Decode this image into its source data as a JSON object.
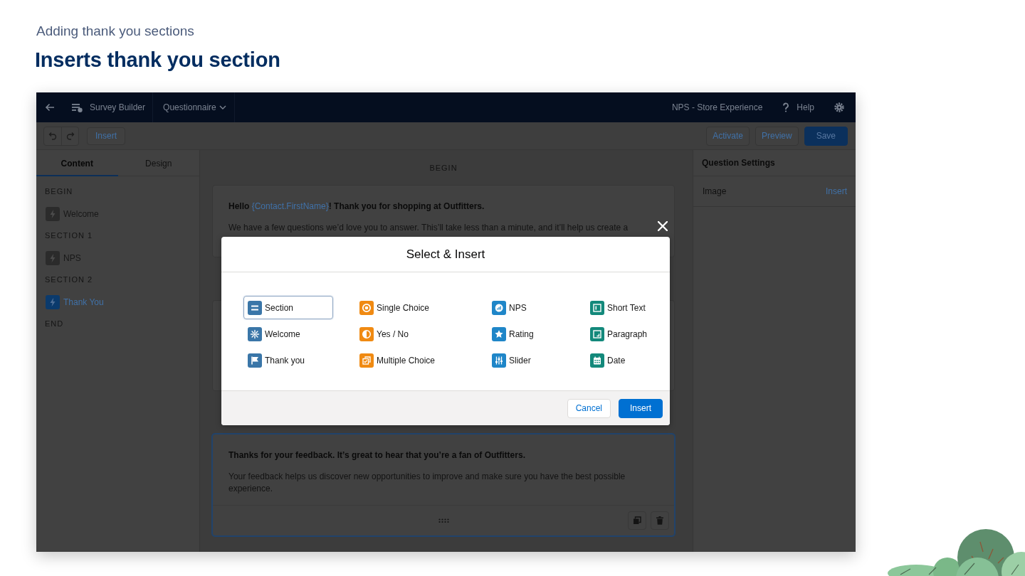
{
  "slide": {
    "subtitle": "Adding thank you sections",
    "title": "Inserts thank you section"
  },
  "window": {
    "nav": {
      "app_name": "Survey Builder",
      "menu": "Questionnaire",
      "survey_name": "NPS - Store Experience",
      "help": "Help"
    },
    "toolbar": {
      "insert": "Insert",
      "actions": [
        {
          "label": "Activate",
          "kind": "neutral"
        },
        {
          "label": "Preview",
          "kind": "neutral"
        },
        {
          "label": "Save",
          "kind": "brand"
        }
      ]
    },
    "sidebar": {
      "tabs": [
        {
          "label": "Content",
          "selected": true
        },
        {
          "label": "Design",
          "selected": false
        }
      ],
      "outline": [
        {
          "heading": "BEGIN",
          "pages": [
            {
              "label": "Welcome",
              "selected": false
            }
          ]
        },
        {
          "heading": "SECTION 1",
          "pages": [
            {
              "label": "NPS",
              "selected": false
            }
          ]
        },
        {
          "heading": "SECTION 2",
          "pages": [
            {
              "label": "Thank You",
              "selected": true
            }
          ]
        },
        {
          "heading": "END"
        }
      ]
    },
    "canvas": {
      "label": "BEGIN",
      "cards": [
        {
          "selected": false,
          "title_parts": [
            {
              "text": "Hello ",
              "kind": "text"
            },
            {
              "text": "{Contact.FirstName}",
              "kind": "merge_field"
            },
            {
              "text": "! Thank you for shopping at Outfitters.",
              "kind": "text"
            }
          ],
          "body": "We have a few questions we’d love you to answer. This’ll take less than a minute, and it’ll help us create a"
        },
        {
          "selected": false
        },
        {
          "selected": true,
          "title_parts": [
            {
              "text": "Thanks for your feedback. It’s great to hear that you’re a fan of Outfitters.",
              "kind": "text"
            }
          ],
          "body": "Your feedback helps us discover new opportunities to improve and make sure you have the best possible experience."
        }
      ]
    },
    "settings_panel": {
      "title": "Question Settings",
      "rows": [
        {
          "label": "Image",
          "action": "Insert"
        }
      ]
    }
  },
  "modal": {
    "title": "Select & Insert",
    "options": [
      {
        "label": "Section",
        "selected": true,
        "color": "#3a76a8"
      },
      {
        "label": "Welcome",
        "selected": false,
        "color": "#3a76a8"
      },
      {
        "label": "Thank you",
        "selected": false,
        "color": "#3a76a8"
      },
      {
        "label": "Single Choice",
        "selected": false,
        "color": "#f08a12"
      },
      {
        "label": "Yes / No",
        "selected": false,
        "color": "#f08a12"
      },
      {
        "label": "Multiple Choice",
        "selected": false,
        "color": "#f08a12"
      },
      {
        "label": "NPS",
        "selected": false,
        "color": "#1f86c8"
      },
      {
        "label": "Rating",
        "selected": false,
        "color": "#1f86c8"
      },
      {
        "label": "Slider",
        "selected": false,
        "color": "#1f86c8"
      },
      {
        "label": "Short Text",
        "selected": false,
        "color": "#13897b"
      },
      {
        "label": "Paragraph",
        "selected": false,
        "color": "#13897b"
      },
      {
        "label": "Date",
        "selected": false,
        "color": "#13897b"
      }
    ],
    "buttons": [
      {
        "label": "Cancel",
        "kind": "neutral"
      },
      {
        "label": "Insert",
        "kind": "brand"
      }
    ]
  }
}
